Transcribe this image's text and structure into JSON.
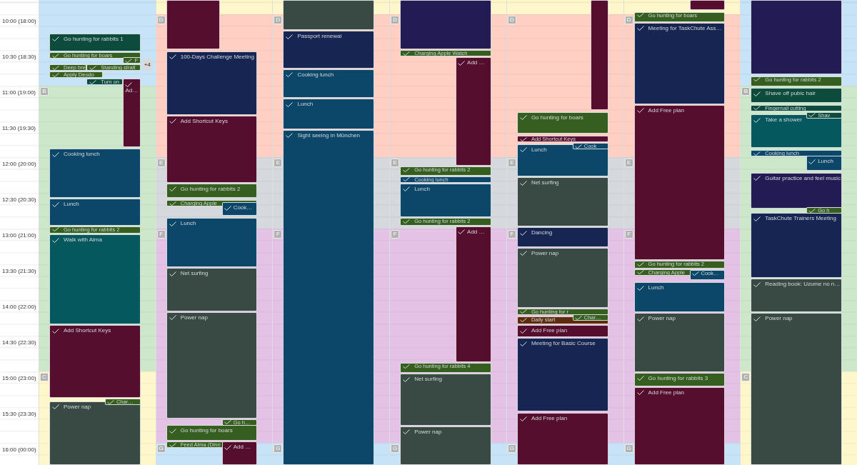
{
  "time_axis": [
    "10:00 (18:00)",
    "10:30 (18:30)",
    "11:00 (19:00)",
    "11:30 (19:30)",
    "12:00 (20:00)",
    "12:30 (20:30)",
    "13:00 (21:00)",
    "13:30 (21:30)",
    "14:00 (22:00)",
    "14:30 (22:30)",
    "15:00 (23:00)",
    "15:30 (23:30)",
    "16:00 (00:00)"
  ],
  "days": [
    {
      "sections": [
        {
          "color": "#c6e3f7"
        },
        {
          "letter": "B",
          "color": "#cde7cb"
        },
        {
          "letter": "C",
          "color": "#fff7cc"
        }
      ],
      "tasks": [
        {
          "title": "Go hunting for rabbits 1",
          "color": "#0d4b3c",
          "done": true
        },
        {
          "title": "Go hunting for boars",
          "color": "#365e20",
          "done": true
        },
        {
          "title": "F",
          "color": "#365e20",
          "done": true
        },
        {
          "title": "Deep bre",
          "color": "#365e20",
          "done": true
        },
        {
          "title": "Standing strait",
          "color": "#365e20",
          "done": true
        },
        {
          "title": "Apply Deodo",
          "color": "#365e20",
          "done": true
        },
        {
          "title": "Turn on",
          "color": "#0d4b3c",
          "done": true
        },
        {
          "title": "Ad…",
          "color": "#550e2d",
          "done": true
        },
        {
          "title": "Cooking lunch",
          "color": "#0c4669",
          "done": true
        },
        {
          "title": "Lunch",
          "color": "#0c4669",
          "done": true
        },
        {
          "title": "Go hunting for rabbits 2",
          "color": "#365e20",
          "done": true
        },
        {
          "title": "Walk with Alma",
          "color": "#05585d",
          "done": true
        },
        {
          "title": "Add Shortcut Keys",
          "color": "#550e2d",
          "done": true
        },
        {
          "title": "Char…",
          "color": "#365e20",
          "done": true
        },
        {
          "title": "Power nap",
          "color": "#394a45",
          "done": true
        }
      ],
      "more": [
        "+4"
      ]
    },
    {
      "sections": [
        {
          "color": "#fff7cc"
        },
        {
          "letter": "D",
          "color": "#ffcfc3"
        },
        {
          "letter": "E",
          "color": "#d5d8dc"
        },
        {
          "letter": "F",
          "color": "#e4c2e6"
        },
        {
          "letter": "G",
          "color": "#c6e3f7"
        }
      ],
      "tasks": [
        {
          "color": "#550e2d"
        },
        {
          "title": "100-Days Challenge Meeting",
          "color": "#172552",
          "done": true
        },
        {
          "title": "Add Shortcut Keys",
          "color": "#550e2d",
          "done": true
        },
        {
          "title": "Go hunting for rabbits 2",
          "color": "#365e20",
          "done": true
        },
        {
          "title": "Charging Apple",
          "color": "#365e20",
          "done": true
        },
        {
          "title": "Cook…",
          "color": "#0c4669",
          "done": true
        },
        {
          "title": "Lunch",
          "color": "#0c4669",
          "done": true
        },
        {
          "title": "Net surfing",
          "color": "#394a45",
          "done": true
        },
        {
          "title": "Power nap",
          "color": "#394a45",
          "done": true
        },
        {
          "title": "Go h…",
          "color": "#365e20",
          "done": true
        },
        {
          "title": "Go hunting for boars",
          "color": "#365e20",
          "done": true
        },
        {
          "title": "Feed Alma (Dinn",
          "color": "#365e20",
          "done": true
        },
        {
          "title": "Add …",
          "color": "#550e2d",
          "done": true
        }
      ]
    },
    {
      "sections": [
        {
          "color": "#fff7cc"
        },
        {
          "letter": "D",
          "color": "#ffcfc3"
        },
        {
          "letter": "E",
          "color": "#d5d8dc"
        },
        {
          "letter": "F",
          "color": "#e4c2e6"
        },
        {
          "letter": "G",
          "color": "#c6e3f7"
        }
      ],
      "tasks": [
        {
          "color": "#394a45"
        },
        {
          "title": "Passport renewal",
          "color": "#172552",
          "done": true
        },
        {
          "title": "Cooking lunch",
          "color": "#0c4669",
          "done": true
        },
        {
          "title": "Lunch",
          "color": "#0c4669",
          "done": true
        },
        {
          "title": "Sight seeing in München",
          "color": "#0c4669",
          "done": true
        }
      ]
    },
    {
      "sections": [
        {
          "color": "#fff7cc"
        },
        {
          "letter": "D",
          "color": "#ffcfc3"
        },
        {
          "letter": "E",
          "color": "#d5d8dc"
        },
        {
          "letter": "F",
          "color": "#e4c2e6"
        },
        {
          "letter": "G",
          "color": "#c6e3f7"
        }
      ],
      "tasks": [
        {
          "color": "#231c54"
        },
        {
          "title": "Charging Apple Watch",
          "color": "#365e20",
          "done": true
        },
        {
          "title": "Add …",
          "color": "#550e2d",
          "done": true
        },
        {
          "title": "Go hunting for rabbits 2",
          "color": "#365e20",
          "done": true
        },
        {
          "title": "Cooking lunch",
          "color": "#0c4669",
          "done": true
        },
        {
          "title": "Lunch",
          "color": "#0c4669",
          "done": true
        },
        {
          "title": "Go hunting for rabbits 2",
          "color": "#365e20",
          "done": true
        },
        {
          "title": "Add …",
          "color": "#550e2d",
          "done": true
        },
        {
          "title": "Go hunting for rabbits 4",
          "color": "#365e20",
          "done": true
        },
        {
          "title": "Net surfing",
          "color": "#394a45",
          "done": true
        },
        {
          "title": "Power nap",
          "color": "#394a45",
          "done": true
        }
      ]
    },
    {
      "sections": [
        {
          "color": "#fff7cc"
        },
        {
          "letter": "D",
          "color": "#ffcfc3"
        },
        {
          "letter": "E",
          "color": "#d5d8dc"
        },
        {
          "letter": "F",
          "color": "#e4c2e6"
        },
        {
          "letter": "G",
          "color": "#c6e3f7"
        }
      ],
      "tasks": [
        {
          "color": "#550e2d"
        },
        {
          "title": "Go hunting for boars",
          "color": "#365e20",
          "done": true
        },
        {
          "title": "Add Shortcut Keys",
          "color": "#550e2d",
          "done": true
        },
        {
          "title": "Cook",
          "color": "#0c4669",
          "done": true
        },
        {
          "title": "Lunch",
          "color": "#0c4669",
          "done": true
        },
        {
          "title": "Net surfing",
          "color": "#394a45",
          "done": true
        },
        {
          "title": "Dancing",
          "color": "#172552",
          "done": true
        },
        {
          "title": "Power nap",
          "color": "#394a45",
          "done": true
        },
        {
          "title": "Go hunting for r",
          "color": "#365e20",
          "done": true
        },
        {
          "title": "Daily start",
          "color": "#5c2c0d",
          "done": true
        },
        {
          "title": "Char…",
          "color": "#365e20",
          "done": true
        },
        {
          "title": "Add Free plan",
          "color": "#550e2d",
          "done": true
        },
        {
          "title": "Meeting for Basic Course",
          "color": "#172552",
          "done": true
        },
        {
          "title": "Add Free plan",
          "color": "#550e2d",
          "done": true
        }
      ]
    },
    {
      "sections": [
        {
          "color": "#fff7cc"
        },
        {
          "letter": "D",
          "color": "#ffcfc3"
        },
        {
          "letter": "E",
          "color": "#d5d8dc"
        },
        {
          "letter": "F",
          "color": "#e4c2e6"
        },
        {
          "letter": "G",
          "color": "#c6e3f7"
        }
      ],
      "tasks": [
        {
          "color": "#550e2d"
        },
        {
          "title": "Go hunting for boars",
          "color": "#365e20",
          "done": true
        },
        {
          "title": "Meeting for TaskChute Ass…",
          "color": "#172552",
          "done": true
        },
        {
          "title": "Add Free plan",
          "color": "#550e2d",
          "done": true
        },
        {
          "title": "Go hunting for rabbits 2",
          "color": "#365e20",
          "done": true
        },
        {
          "title": "Charging Apple",
          "color": "#365e20",
          "done": true
        },
        {
          "title": "Cook…",
          "color": "#0c4669",
          "done": true
        },
        {
          "title": "Lunch",
          "color": "#0c4669",
          "done": true
        },
        {
          "title": "Power nap",
          "color": "#394a45",
          "done": true
        },
        {
          "title": "Go hunting for rabbits 3",
          "color": "#365e20",
          "done": true
        },
        {
          "title": "Add Free plan",
          "color": "#550e2d",
          "done": true
        }
      ]
    },
    {
      "sections": [
        {
          "color": "#c6e3f7"
        },
        {
          "letter": "B",
          "color": "#cde7cb"
        },
        {
          "letter": "C",
          "color": "#fff7cc"
        }
      ],
      "tasks": [
        {
          "color": "#231c54"
        },
        {
          "title": "Go hunting for rabbits 2",
          "color": "#365e20",
          "done": true
        },
        {
          "title": "Shave off pubic hair",
          "color": "#0d4b3c",
          "done": true
        },
        {
          "title": "Fingernail cutting",
          "color": "#0d4b3c",
          "done": true
        },
        {
          "title": "Shav",
          "color": "#0d4b3c",
          "done": true
        },
        {
          "title": "Take a shower",
          "color": "#05585d",
          "done": true
        },
        {
          "title": "Cooking lunch",
          "color": "#0c4669",
          "done": true
        },
        {
          "title": "Lunch",
          "color": "#0c4669",
          "done": true
        },
        {
          "title": "Guitar practice and feel music",
          "color": "#231c54",
          "done": true
        },
        {
          "title": "Go h",
          "color": "#365e20",
          "done": true
        },
        {
          "title": "TaskChute Trainers Meeting",
          "color": "#172552",
          "done": true
        },
        {
          "title": "Reading book: Uzume no n…",
          "color": "#394a45",
          "done": true
        },
        {
          "title": "Power nap",
          "color": "#394a45",
          "done": true
        }
      ]
    }
  ]
}
